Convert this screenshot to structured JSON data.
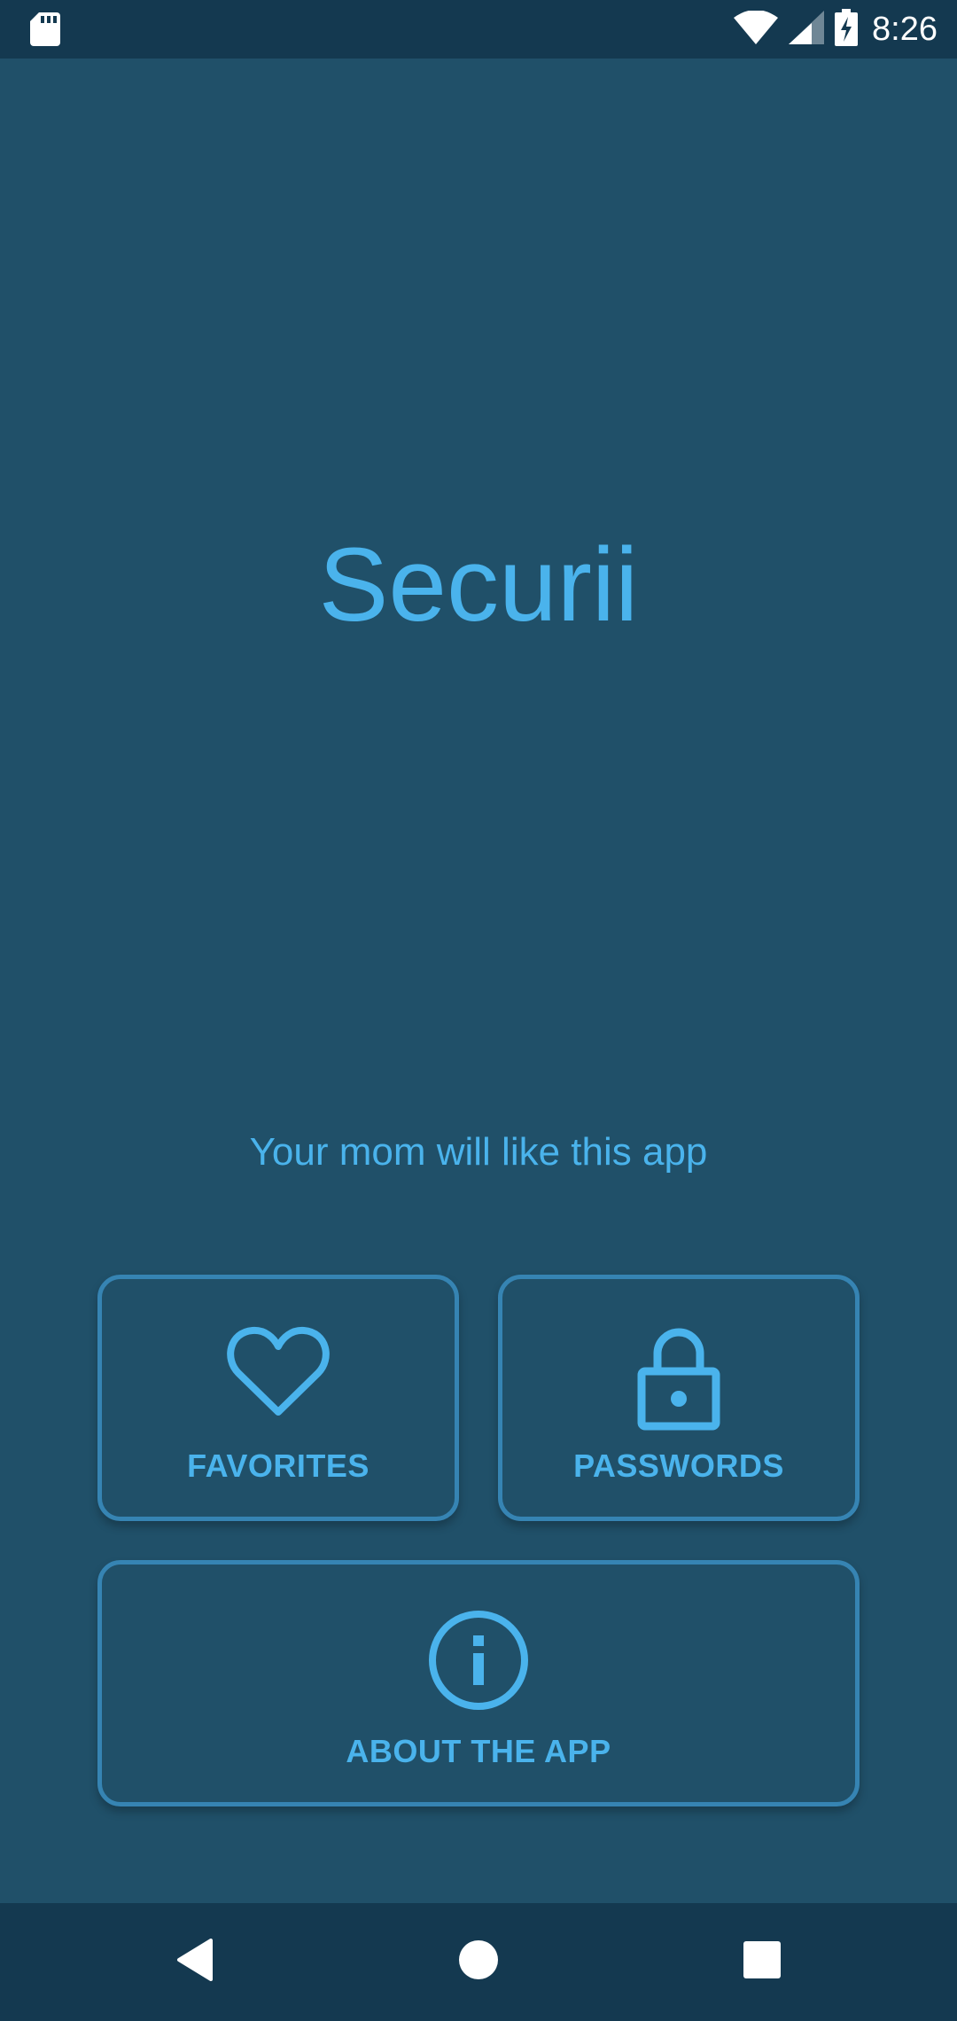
{
  "status_bar": {
    "time": "8:26",
    "icons": [
      "sd-card-icon",
      "wifi-icon",
      "cell-signal-icon",
      "battery-charging-icon"
    ]
  },
  "main": {
    "title": "Securii",
    "tagline": "Your mom will like this app"
  },
  "buttons": {
    "favorites": {
      "label": "FAVORITES",
      "icon": "heart-icon"
    },
    "passwords": {
      "label": "PASSWORDS",
      "icon": "lock-icon"
    },
    "about": {
      "label": "ABOUT THE APP",
      "icon": "info-icon"
    }
  },
  "nav_bar": {
    "icons": [
      "back-icon",
      "home-icon",
      "recents-icon"
    ]
  },
  "colors": {
    "background": "#205069",
    "bars": "#143950",
    "accent": "#4ab3ec",
    "card_border": "#3684b3"
  }
}
